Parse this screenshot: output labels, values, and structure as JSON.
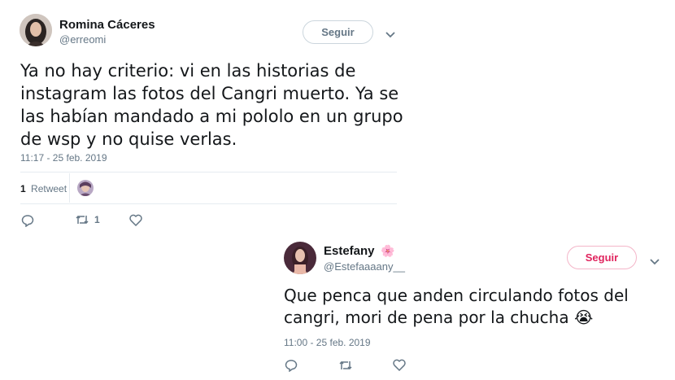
{
  "tweet1": {
    "author_name": "Romina Cáceres",
    "author_handle": "@erreomi",
    "follow_label": "Seguir",
    "text_lines": [
      "Ya no hay criterio: vi en las historias de",
      "instagram las fotos del Cangri muerto. Ya se",
      "las habían mandado a mi pololo en un grupo",
      "de wsp y no quise verlas."
    ],
    "timestamp": "11:17 - 25 feb. 2019",
    "retweet_count": "1",
    "retweet_label": "Retweet",
    "action_retweet_count": "1",
    "colors": {
      "follow_border": "#ccd6dd",
      "follow_text": "#657786"
    }
  },
  "tweet2": {
    "author_name": "Estefany",
    "author_emoji": "🌸",
    "author_handle": "@Estefaaaany__",
    "follow_label": "Seguir",
    "text_lines": [
      "Que penca que anden circulando fotos del",
      "cangri, mori de pena por la chucha"
    ],
    "text_emoji": "😭",
    "timestamp": "11:00 - 25 feb. 2019",
    "colors": {
      "follow_border": "#f4b6c9",
      "follow_text": "#e0245e"
    }
  }
}
